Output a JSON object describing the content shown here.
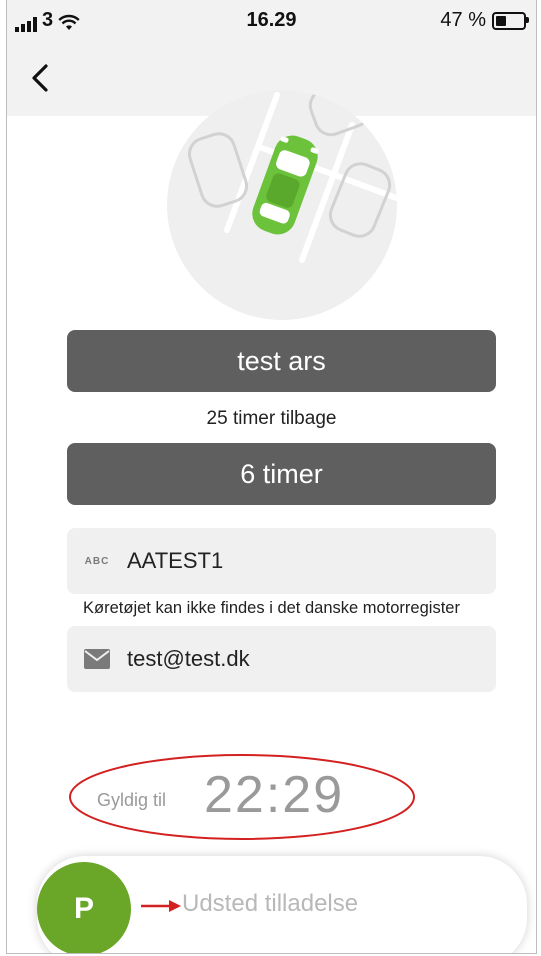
{
  "status_bar": {
    "carrier": "3",
    "time": "16.29",
    "battery": "47 %",
    "battery_level": 0.47
  },
  "nav": {
    "back_icon": "chevron-left-icon"
  },
  "illustration": {
    "icon": "parked-car-illustration",
    "car_color": "#6cc23a"
  },
  "parking": {
    "name": "test ars",
    "remaining_text": "25 timer tilbage",
    "duration": "6 timer"
  },
  "vehicle": {
    "plate_icon": "ABC",
    "plate": "AATEST1",
    "note": "Køretøjet kan ikke findes i det danske motorregister"
  },
  "contact": {
    "email_icon": "envelope-icon",
    "email": "test@test.dk"
  },
  "validity": {
    "label": "Gyldig til",
    "time": "22:29",
    "highlight_color": "#d32020"
  },
  "issue": {
    "button_letter": "P",
    "label": "Udsted tilladelse",
    "accent": "#6aa628"
  }
}
